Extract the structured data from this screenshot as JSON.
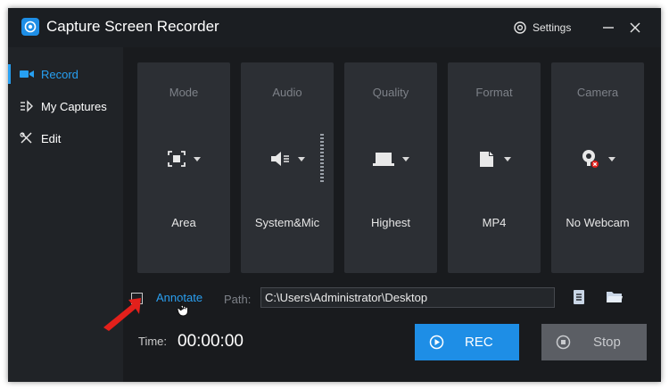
{
  "app": {
    "title": "Capture Screen Recorder",
    "settings_label": "Settings"
  },
  "sidebar": {
    "items": [
      {
        "label": "Record",
        "icon": "video-camera-icon",
        "active": true
      },
      {
        "label": "My Captures",
        "icon": "captures-list-icon",
        "active": false
      },
      {
        "label": "Edit",
        "icon": "edit-tools-icon",
        "active": false
      }
    ]
  },
  "cards": [
    {
      "title": "Mode",
      "value": "Area",
      "icon": "area-select-icon"
    },
    {
      "title": "Audio",
      "value": "System&Mic",
      "icon": "speaker-icon"
    },
    {
      "title": "Quality",
      "value": "Highest",
      "icon": "laptop-icon"
    },
    {
      "title": "Format",
      "value": "MP4",
      "icon": "file-icon"
    },
    {
      "title": "Camera",
      "value": "No Webcam",
      "icon": "webcam-off-icon"
    }
  ],
  "options": {
    "annotate_label": "Annotate",
    "annotate_checked": false
  },
  "path": {
    "label": "Path:",
    "value": "C:\\Users\\Administrator\\Desktop"
  },
  "timer": {
    "label": "Time:",
    "value": "00:00:00"
  },
  "buttons": {
    "rec_label": "REC",
    "stop_label": "Stop"
  },
  "colors": {
    "accent": "#1e8ee6",
    "background": "#191b1e",
    "card": "#2c2f34",
    "pointer_arrow": "#e3201b"
  }
}
